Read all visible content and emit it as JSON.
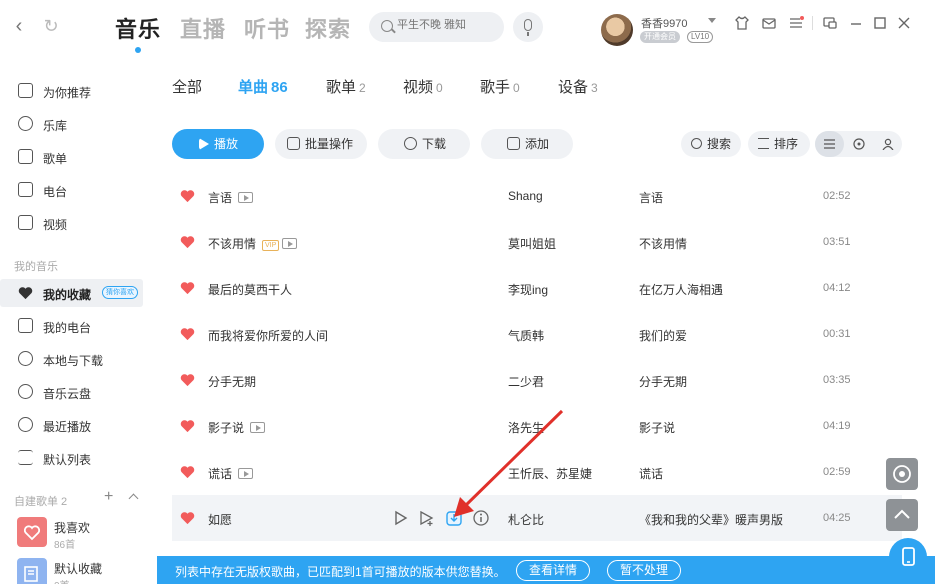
{
  "topbar": {
    "tabs": [
      {
        "label": "音乐",
        "active": true
      },
      {
        "label": "直播",
        "active": false
      },
      {
        "label": "听书",
        "active": false
      },
      {
        "label": "探索",
        "active": false
      }
    ],
    "search_placeholder": "平生不晚 雅知",
    "user": {
      "name": "香香9970",
      "vip_label": "开通会员",
      "level": "LV10"
    }
  },
  "sidebar": {
    "items": [
      {
        "label": "为你推荐",
        "icon": "recommend-icon"
      },
      {
        "label": "乐库",
        "icon": "library-icon"
      },
      {
        "label": "歌单",
        "icon": "playlist-icon"
      },
      {
        "label": "电台",
        "icon": "radio-icon"
      },
      {
        "label": "视频",
        "icon": "video-icon"
      }
    ],
    "my_music_title": "我的音乐",
    "my_items": [
      {
        "label": "我的收藏",
        "icon": "heart-icon",
        "active": true,
        "tag": "猜你喜欢"
      },
      {
        "label": "我的电台",
        "icon": "radio-icon"
      },
      {
        "label": "本地与下载",
        "icon": "download-icon"
      },
      {
        "label": "音乐云盘",
        "icon": "cloud-icon"
      },
      {
        "label": "最近播放",
        "icon": "clock-icon"
      },
      {
        "label": "默认列表",
        "icon": "list-icon"
      }
    ],
    "custom_title": "自建歌单 2",
    "playlists": [
      {
        "name": "我喜欢",
        "count": "86首"
      },
      {
        "name": "默认收藏",
        "count": "0首"
      }
    ]
  },
  "subtabs": [
    {
      "label": "全部",
      "count": ""
    },
    {
      "label": "单曲",
      "count": "86",
      "active": true
    },
    {
      "label": "歌单",
      "count": "2"
    },
    {
      "label": "视频",
      "count": "0"
    },
    {
      "label": "歌手",
      "count": "0"
    },
    {
      "label": "设备",
      "count": "3"
    }
  ],
  "toolbar": {
    "play": "播放",
    "batch": "批量操作",
    "download": "下载",
    "add": "添加",
    "search": "搜索",
    "sort": "排序"
  },
  "songs": [
    {
      "title": "言语",
      "mv": true,
      "vip": false,
      "artist": "Shang",
      "album": "言语",
      "duration": "02:52"
    },
    {
      "title": "不该用情",
      "mv": true,
      "vip": true,
      "artist": "莫叫姐姐",
      "album": "不该用情",
      "duration": "03:51"
    },
    {
      "title": "最后的莫西干人",
      "mv": false,
      "vip": false,
      "artist": "李现ing",
      "album": "在亿万人海相遇",
      "duration": "04:12"
    },
    {
      "title": "而我将爱你所爱的人间",
      "mv": false,
      "vip": false,
      "artist": "气质韩",
      "album": "我们的爱",
      "duration": "00:31"
    },
    {
      "title": "分手无期",
      "mv": false,
      "vip": false,
      "artist": "二少君",
      "album": "分手无期",
      "duration": "03:35"
    },
    {
      "title": "影子说",
      "mv": true,
      "vip": false,
      "artist": "洛先生",
      "album": "影子说",
      "duration": "04:19"
    },
    {
      "title": "谎话",
      "mv": true,
      "vip": false,
      "artist": "王忻辰、苏星婕",
      "album": "谎话",
      "duration": "02:59"
    },
    {
      "title": "如愿",
      "mv": false,
      "vip": false,
      "artist": "札仑比",
      "album": "《我和我的父辈》暖声男版",
      "duration": "04:25"
    }
  ],
  "vip_tag_label": "VIP",
  "notice": {
    "text": "列表中存在无版权歌曲，已匹配到1首可播放的版本供您替换。",
    "details_button": "查看详情",
    "ignore_button": "暂不处理"
  },
  "colors": {
    "accent": "#2ea4f2",
    "heart": "#f25b5b",
    "annotation_arrow": "#e0302a"
  }
}
